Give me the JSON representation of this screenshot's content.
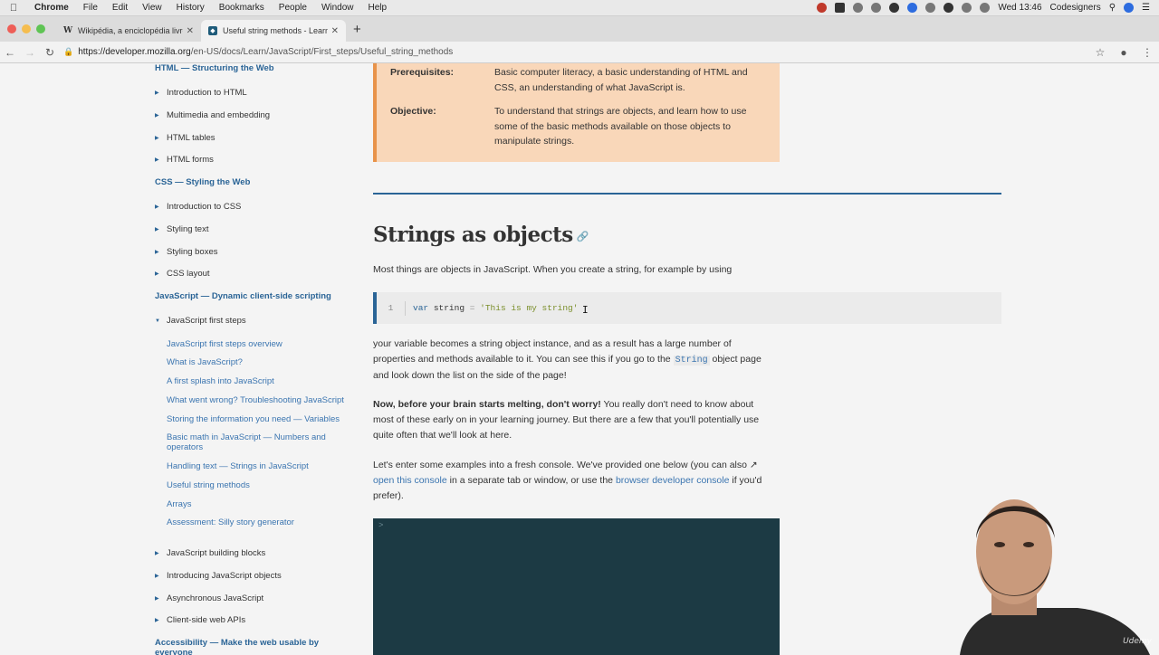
{
  "menubar": {
    "app": "Chrome",
    "items": [
      "File",
      "Edit",
      "View",
      "History",
      "Bookmarks",
      "People",
      "Window",
      "Help"
    ],
    "clock": "Wed 13:46",
    "user": "Codesigners"
  },
  "tabs": [
    {
      "title": "Wikipédia, a enciclopédia livre",
      "favicon": "W",
      "active": false
    },
    {
      "title": "Useful string methods - Learn",
      "favicon": "mdn",
      "active": true
    }
  ],
  "address": {
    "url_host": "https://developer.mozilla.org",
    "url_path": "/en-US/docs/Learn/JavaScript/First_steps/Useful_string_methods"
  },
  "sidebar": {
    "html_heading": "HTML — Structuring the Web",
    "html_items": [
      "Introduction to HTML",
      "Multimedia and embedding",
      "HTML tables",
      "HTML forms"
    ],
    "css_heading": "CSS — Styling the Web",
    "css_items": [
      "Introduction to CSS",
      "Styling text",
      "Styling boxes",
      "CSS layout"
    ],
    "js_heading": "JavaScript — Dynamic client-side scripting",
    "js_first_steps": "JavaScript first steps",
    "js_links": [
      "JavaScript first steps overview",
      "What is JavaScript?",
      "A first splash into JavaScript",
      "What went wrong? Troubleshooting JavaScript",
      "Storing the information you need — Variables",
      "Basic math in JavaScript — Numbers and operators",
      "Handling text — Strings in JavaScript",
      "Useful string methods",
      "Arrays",
      "Assessment: Silly story generator"
    ],
    "js_items": [
      "JavaScript building blocks",
      "Introducing JavaScript objects",
      "Asynchronous JavaScript",
      "Client-side web APIs"
    ],
    "a11y_heading": "Accessibility — Make the web usable by everyone"
  },
  "prereq": {
    "prereq_label": "Prerequisites:",
    "prereq_text": "Basic computer literacy, a basic understanding of HTML and CSS, an understanding of what JavaScript is.",
    "objective_label": "Objective:",
    "objective_text": "To understand that strings are objects, and learn how to use some of the basic methods available on those objects to manipulate strings."
  },
  "article": {
    "heading": "Strings as objects",
    "p1": "Most things are objects in JavaScript. When you create a string, for example by using",
    "code": {
      "line_no": "1",
      "kw": "var",
      "ident": "string",
      "op": "=",
      "str": "'This is my string'"
    },
    "p2_a": "your variable becomes a string object instance, and as a result has a large number of properties and methods available to it. You can see this if you go to the ",
    "p2_code": "String",
    "p2_b": " object page and look down the list on the side of the page!",
    "p3_bold": "Now, before your brain starts melting, don't worry!",
    "p3_rest": " You really don't need to know about most of these early on in your learning journey. But there are a few that you'll potentially use quite often that we'll look at here.",
    "p4_a": "Let's enter some examples into a fresh console. We've provided one below (you can also ",
    "p4_link1": "open this console",
    "p4_b": " in a separate tab or window, or use the ",
    "p4_link2": "browser developer console",
    "p4_c": " if you'd prefer).",
    "console_prompt": ">"
  },
  "watermark": "Udemy"
}
